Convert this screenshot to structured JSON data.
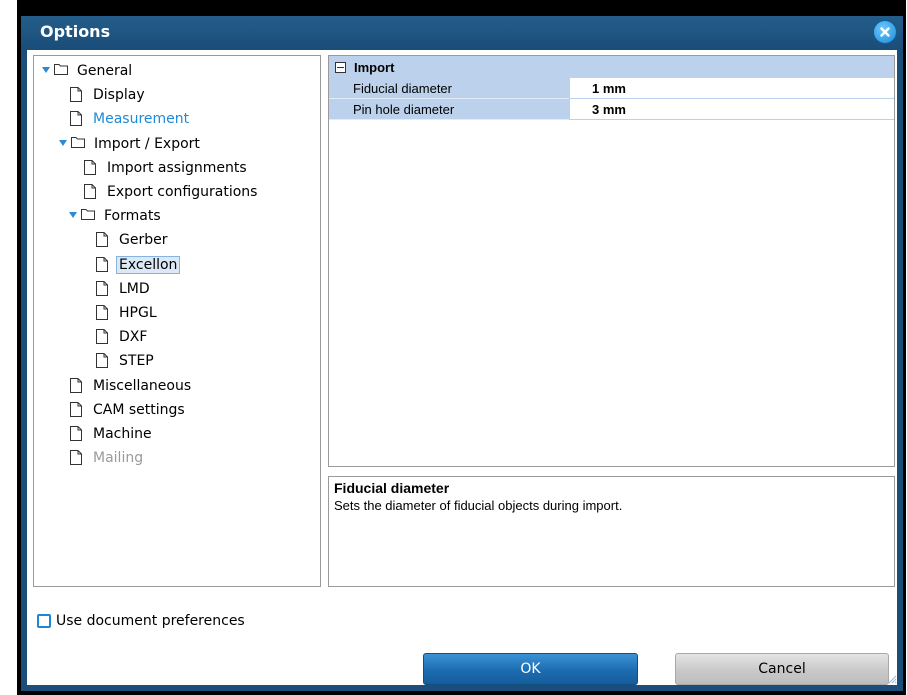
{
  "window": {
    "title": "Options"
  },
  "tree": [
    {
      "label": "General",
      "type": "folder",
      "level": 0,
      "expanded": true
    },
    {
      "label": "Display",
      "type": "file",
      "level": 1
    },
    {
      "label": "Measurement",
      "type": "file",
      "level": 1,
      "accent": true
    },
    {
      "label": "Import / Export",
      "type": "folder",
      "level": 0,
      "expanded": true
    },
    {
      "label": "Import assignments",
      "type": "file",
      "level": 2
    },
    {
      "label": "Export configurations",
      "type": "file",
      "level": 2
    },
    {
      "label": "Formats",
      "type": "folder",
      "level": 1,
      "expanded": true
    },
    {
      "label": "Gerber",
      "type": "file",
      "level": 3
    },
    {
      "label": "Excellon",
      "type": "file",
      "level": 3,
      "selected": true
    },
    {
      "label": "LMD",
      "type": "file",
      "level": 3
    },
    {
      "label": "HPGL",
      "type": "file",
      "level": 3
    },
    {
      "label": "DXF",
      "type": "file",
      "level": 3
    },
    {
      "label": "STEP",
      "type": "file",
      "level": 3
    },
    {
      "label": "Miscellaneous",
      "type": "file",
      "level": 1
    },
    {
      "label": "CAM settings",
      "type": "file",
      "level": 1
    },
    {
      "label": "Machine",
      "type": "file",
      "level": 1
    },
    {
      "label": "Mailing",
      "type": "file",
      "level": 1,
      "disabled": true
    }
  ],
  "properties": {
    "category": "Import",
    "rows": [
      {
        "name": "Fiducial diameter",
        "value": "1 mm"
      },
      {
        "name": "Pin hole diameter",
        "value": "3 mm"
      }
    ]
  },
  "description": {
    "title": "Fiducial diameter",
    "text": "Sets the diameter of fiducial objects during import."
  },
  "checkbox": {
    "label": "Use document preferences",
    "checked": false
  },
  "buttons": {
    "ok": "OK",
    "cancel": "Cancel"
  },
  "colors": {
    "accent": "#1f8ad8",
    "titlebar": "#1b4f79",
    "grid_header": "#bcd2ec"
  }
}
